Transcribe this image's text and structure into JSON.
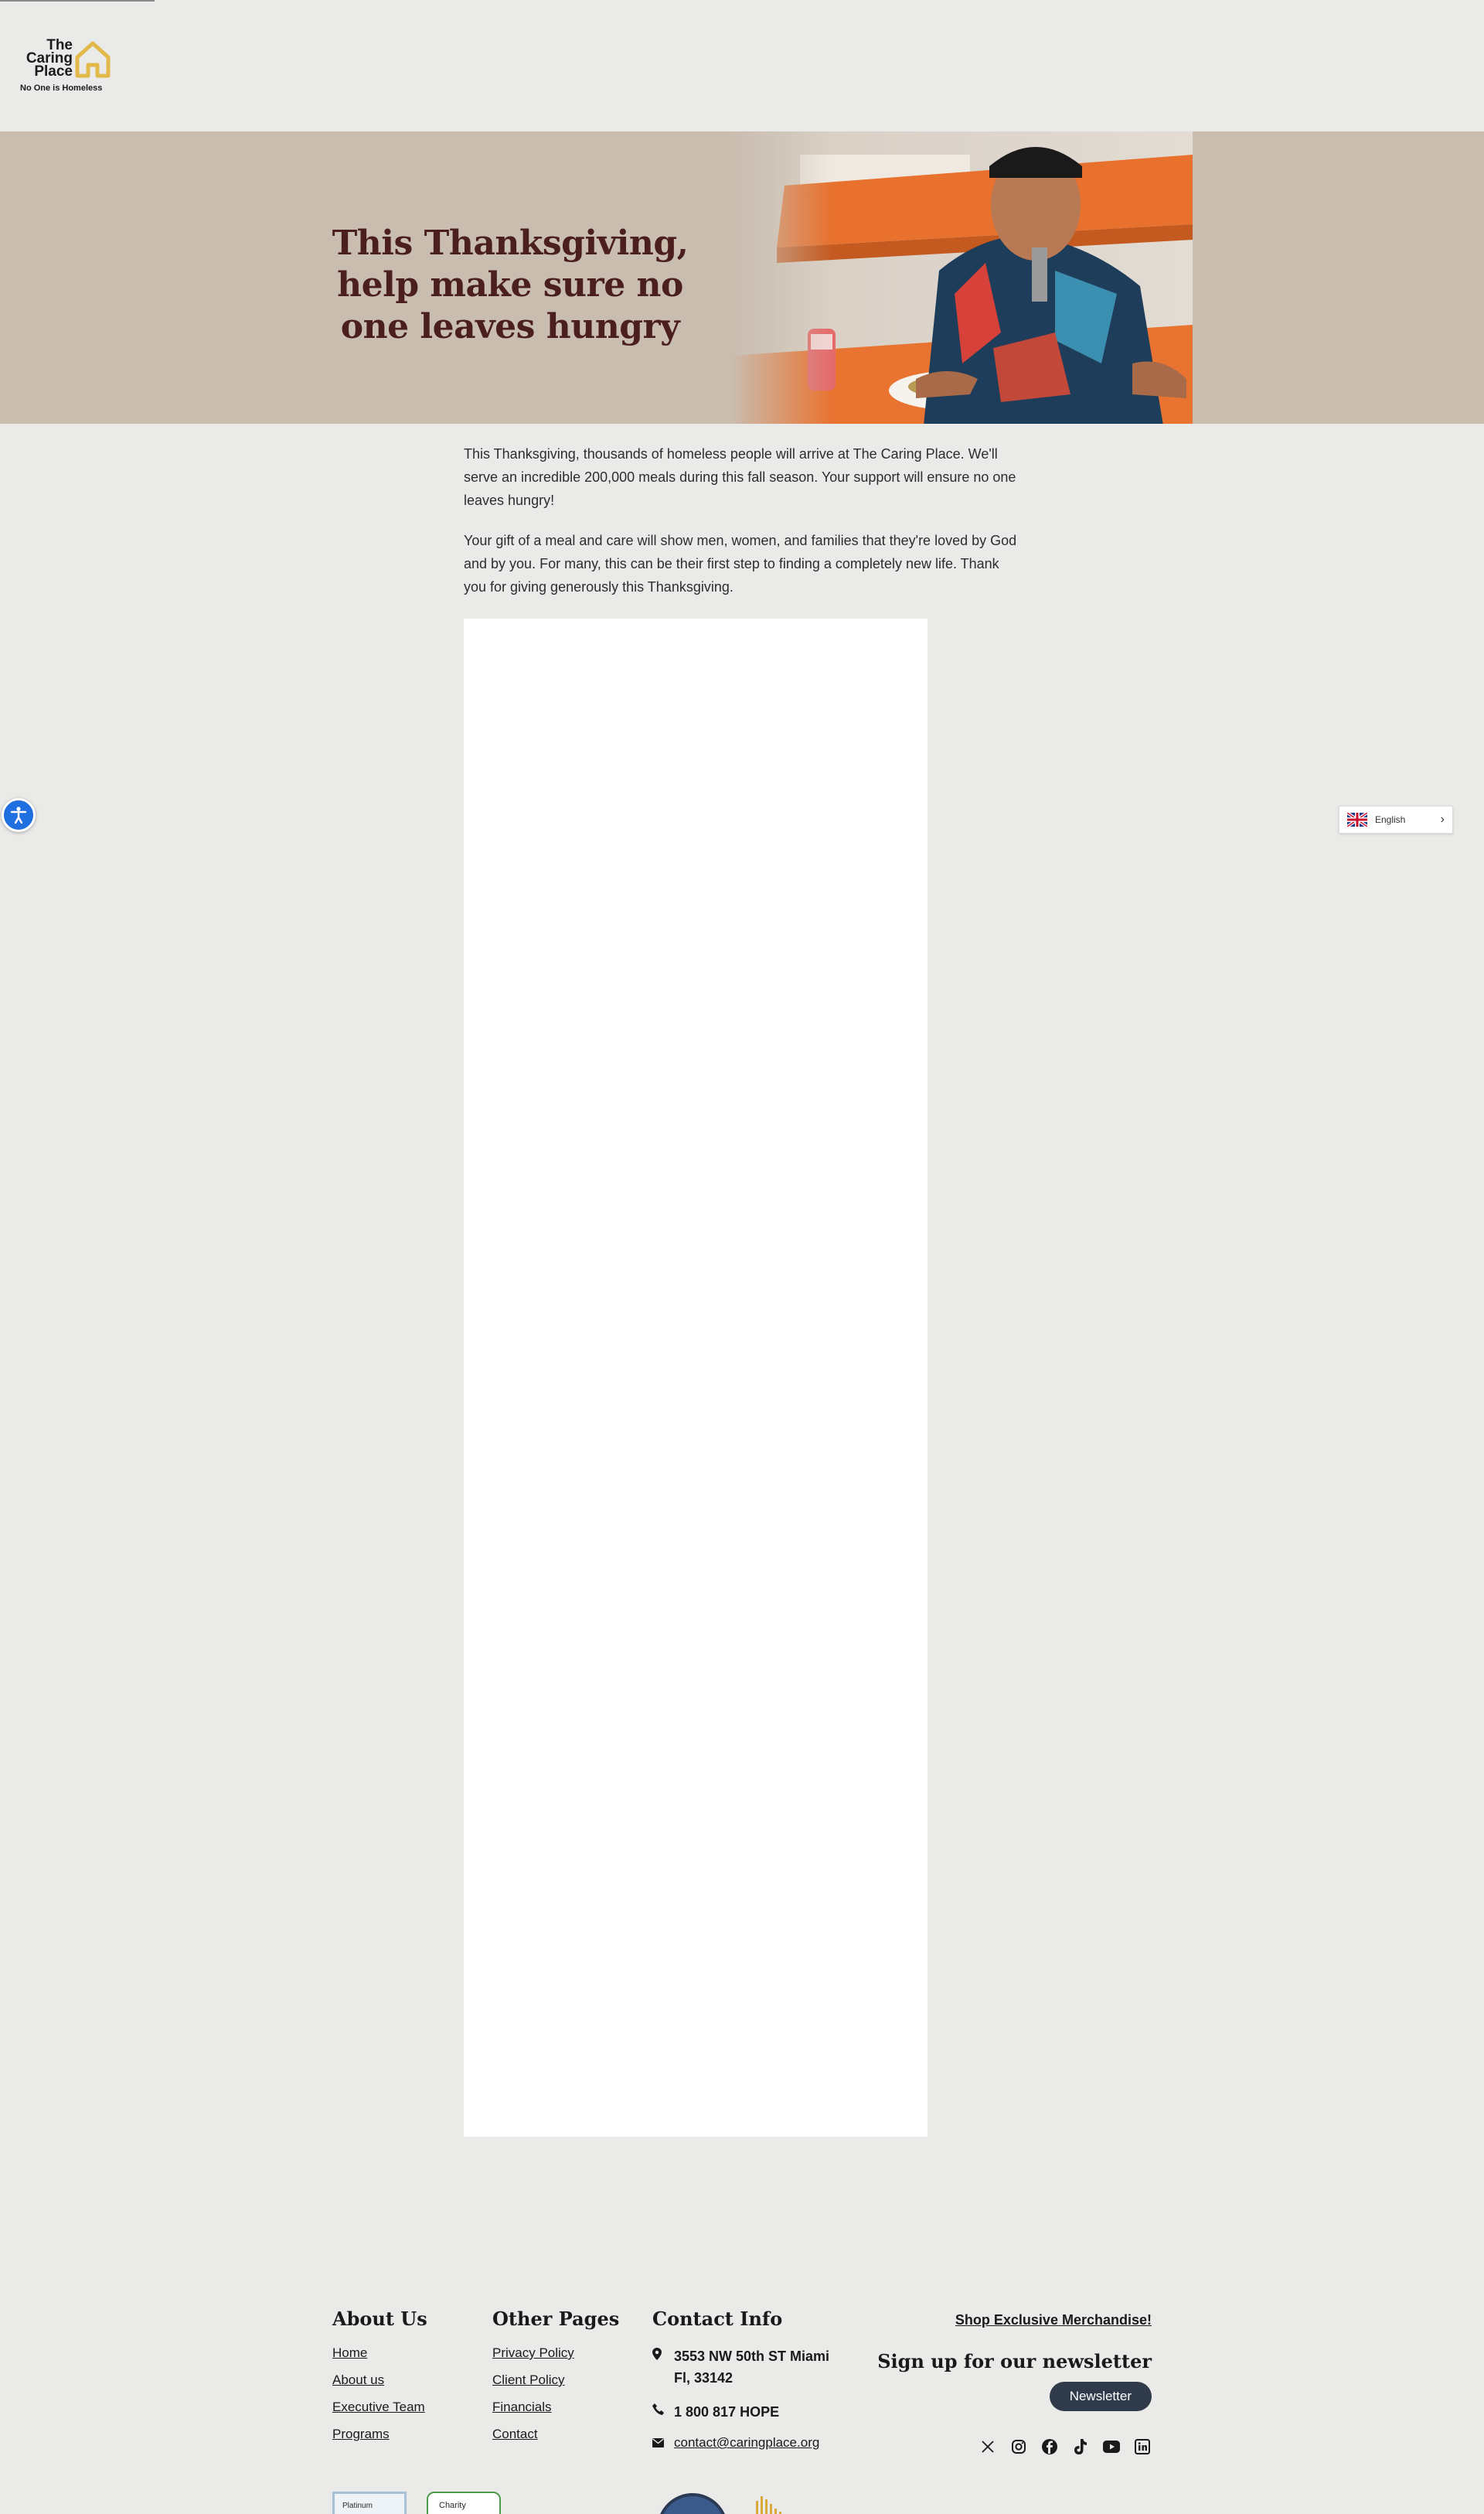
{
  "logo": {
    "line1": "The",
    "line2": "Caring",
    "line3": "Place",
    "tagline": "No One is Homeless"
  },
  "hero": {
    "title": "This Thanksgiving, help make sure no one leaves hungry"
  },
  "body": {
    "paragraph1": "This Thanksgiving, thousands of homeless people will arrive at The Caring Place. We'll serve an incredible 200,000 meals during this fall season. Your support will ensure no one leaves hungry!",
    "paragraph2": "Your gift of a meal and care will show men, women, and families that they're loved by God and by you. For many, this can be their first step to finding a completely new life. Thank you for giving generously this Thanksgiving."
  },
  "language": {
    "selected": "English"
  },
  "footer": {
    "about": {
      "heading": "About Us",
      "links": [
        "Home",
        "About us",
        "Executive Team",
        "Programs"
      ]
    },
    "other": {
      "heading": "Other Pages",
      "links": [
        "Privacy Policy",
        "Client Policy",
        "Financials",
        "Contact"
      ]
    },
    "contact": {
      "heading": "Contact Info",
      "address_line1": "3553 NW 50th ST Miami",
      "address_line2": "Fl, 33142",
      "phone": "1 800 817 HOPE",
      "email": "contact@caringplace.org"
    },
    "shop_link": "Shop Exclusive Merchandise!",
    "newsletter_heading": "Sign up for our newsletter",
    "newsletter_button": "Newsletter",
    "socials": [
      "x-icon",
      "instagram-icon",
      "facebook-icon",
      "tiktok-icon",
      "youtube-icon",
      "linkedin-icon"
    ],
    "badges": {
      "badge1": "Platinum",
      "badge2": "Charity"
    }
  },
  "colors": {
    "hero_bg": "#c9bdb0",
    "hero_title": "#4a1f1e",
    "page_bg": "#eaeae8",
    "logo_gold": "#e2b84a",
    "newsletter_button": "#2f3a4a",
    "accessibility_blue": "#1f6fe0"
  }
}
